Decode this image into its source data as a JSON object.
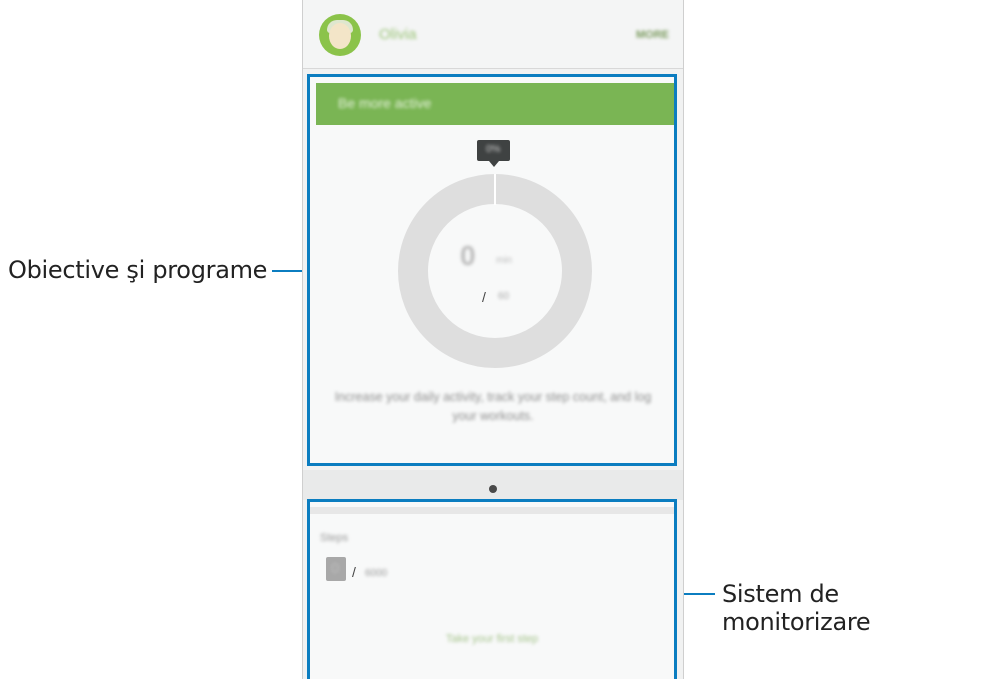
{
  "callouts": {
    "left": "Obiective şi programe",
    "right": "Sistem de monitorizare"
  },
  "header": {
    "name": "Olivia",
    "more": "MORE"
  },
  "goal_card": {
    "title": "Be more active",
    "progress_percent": "0%",
    "progress": 0,
    "value": "0",
    "unit": "min",
    "slash": "/",
    "goal": "60",
    "description": "Increase your daily activity, track your step count, and log your workouts."
  },
  "pager": {
    "active_index": 0,
    "count": 1
  },
  "steps_card": {
    "label": "Steps",
    "value": "0",
    "slash": "/",
    "goal": "6000",
    "cta": "Take your first step"
  },
  "colors": {
    "accent_callout": "#0b7dc0",
    "green": "#7ab554",
    "ring": "#dedede"
  }
}
